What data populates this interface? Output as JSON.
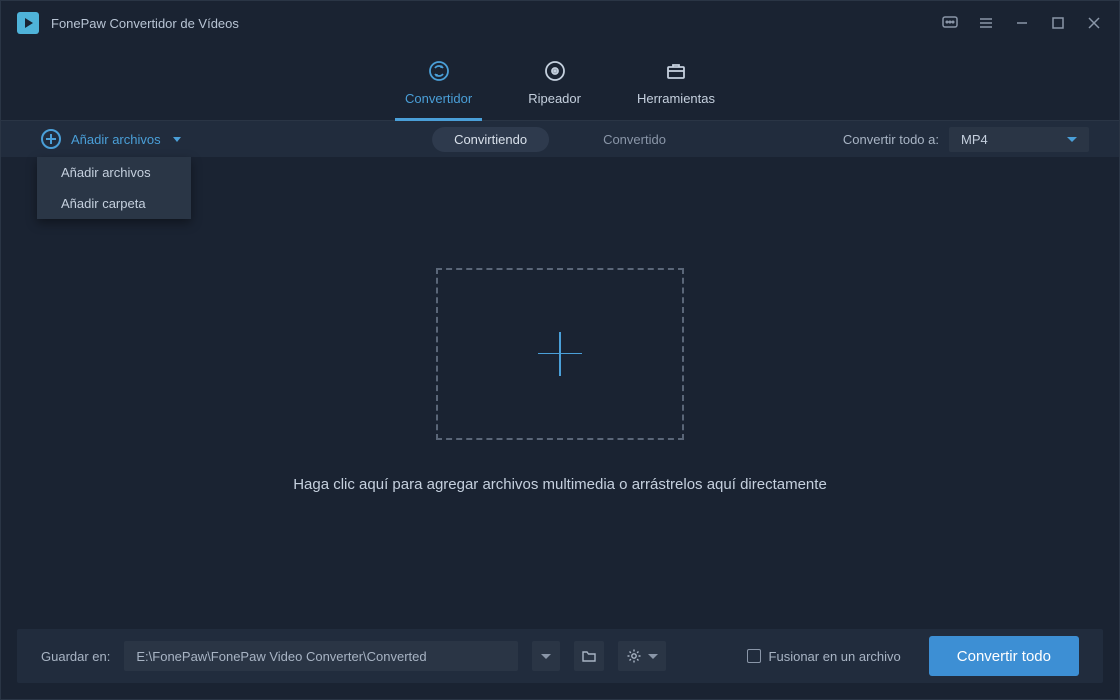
{
  "app": {
    "title": "FonePaw Convertidor de Vídeos"
  },
  "nav": {
    "converter": "Convertidor",
    "ripper": "Ripeador",
    "tools": "Herramientas"
  },
  "subbar": {
    "add_label": "Añadir archivos",
    "dropdown": {
      "add_files": "Añadir archivos",
      "add_folder": "Añadir carpeta"
    },
    "tab_converting": "Convirtiendo",
    "tab_converted": "Convertido",
    "convert_all_to_label": "Convertir todo a:",
    "format_selected": "MP4"
  },
  "dropzone": {
    "text": "Haga clic aquí para agregar archivos multimedia o arrástrelos aquí directamente"
  },
  "bottom": {
    "save_label": "Guardar en:",
    "path": "E:\\FonePaw\\FonePaw Video Converter\\Converted",
    "merge_label": "Fusionar en un archivo",
    "convert_all": "Convertir todo"
  }
}
